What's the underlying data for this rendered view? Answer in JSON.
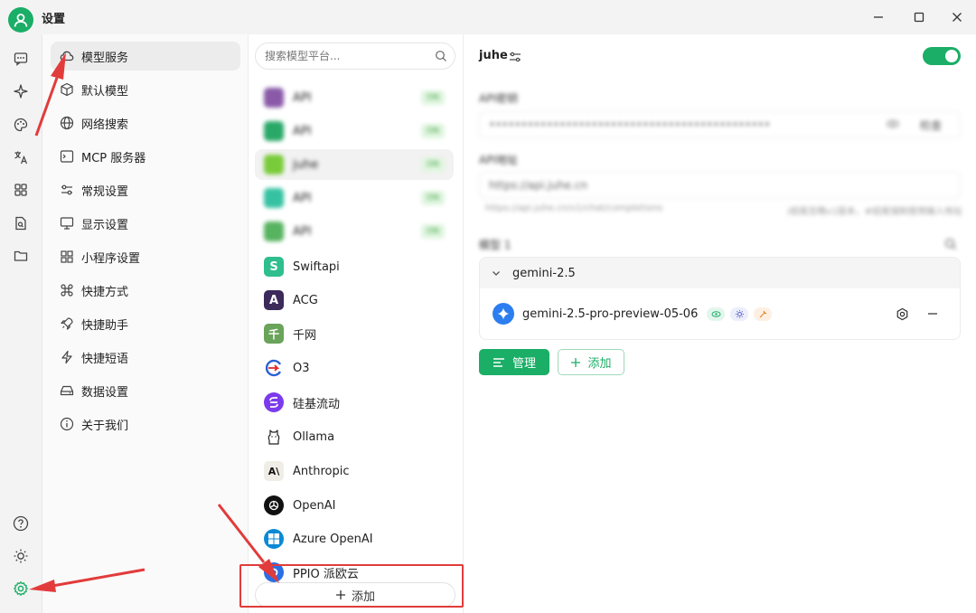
{
  "window": {
    "title": "设置"
  },
  "colors": {
    "accent": "#1aae66",
    "annotation": "#e23b3b"
  },
  "rail_icons": [
    "chat-icon",
    "sparkle-icon",
    "palette-icon",
    "translate-icon",
    "apps-grid-icon",
    "document-search-icon",
    "folder-icon",
    "help-icon",
    "brightness-icon",
    "settings-gear-icon"
  ],
  "settings_nav": [
    {
      "label": "模型服务",
      "icon": "cloud-icon",
      "active": true
    },
    {
      "label": "默认模型",
      "icon": "cube-icon"
    },
    {
      "label": "网络搜索",
      "icon": "globe-icon"
    },
    {
      "label": "MCP 服务器",
      "icon": "terminal-icon"
    },
    {
      "label": "常规设置",
      "icon": "sliders-icon"
    },
    {
      "label": "显示设置",
      "icon": "monitor-icon"
    },
    {
      "label": "小程序设置",
      "icon": "grid-icon"
    },
    {
      "label": "快捷方式",
      "icon": "command-icon"
    },
    {
      "label": "快捷助手",
      "icon": "rocket-icon"
    },
    {
      "label": "快捷短语",
      "icon": "zap-icon"
    },
    {
      "label": "数据设置",
      "icon": "drive-icon"
    },
    {
      "label": "关于我们",
      "icon": "info-icon"
    }
  ],
  "providers": {
    "search_placeholder": "搜索模型平台...",
    "items": [
      {
        "name": "API",
        "logo_color": "#8a5aa8",
        "letter": "",
        "blurred": true,
        "badge": "ON"
      },
      {
        "name": "API",
        "logo_color": "#2aa868",
        "letter": "",
        "blurred": true,
        "badge": "ON"
      },
      {
        "name": "juhe",
        "logo_color": "#7acb3a",
        "letter": "",
        "blurred": true,
        "badge": "ON",
        "active": true
      },
      {
        "name": "API",
        "logo_color": "#36c2a2",
        "letter": "",
        "blurred": true,
        "badge": "ON"
      },
      {
        "name": "API",
        "logo_color": "#57b360",
        "letter": "",
        "blurred": true,
        "badge": "ON"
      },
      {
        "name": "Swiftapi",
        "logo_color": "#2fbe8e",
        "letter": "S"
      },
      {
        "name": "ACG",
        "logo_color": "#3b2a5a",
        "letter": "A"
      },
      {
        "name": "千网",
        "logo_color": "#6aa35a",
        "letter": "千"
      },
      {
        "name": "O3",
        "logo_color": "#ffffff",
        "letter": ""
      },
      {
        "name": "硅基流动",
        "logo_color": "#7c3aed",
        "letter": ""
      },
      {
        "name": "Ollama",
        "logo_color": "#ffffff",
        "letter": ""
      },
      {
        "name": "Anthropic",
        "logo_color": "#f0ede6",
        "letter": "A\\"
      },
      {
        "name": "OpenAI",
        "logo_color": "#111111",
        "letter": ""
      },
      {
        "name": "Azure OpenAI",
        "logo_color": "#0a8ad6",
        "letter": ""
      },
      {
        "name": "PPIO 派欧云",
        "logo_color": "#2b6fe6",
        "letter": ""
      }
    ],
    "add_label": "添加"
  },
  "detail": {
    "provider_name": "juhe",
    "enabled": true,
    "api_key": {
      "label": "API密钥",
      "value": "••••••••••••••••••••••••••••••••••••••••••••",
      "check_label": "检查"
    },
    "api_host": {
      "label": "API地址",
      "value": "https://api.juhe.cn",
      "hint_left": "https://api.juhe.cn/v1/chat/completions",
      "hint_right": "/结尾忽略v1版本，#结尾强制使用输入地址"
    },
    "models_label": "模型",
    "model_count": "1",
    "group": {
      "name": "gemini-2.5",
      "models": [
        {
          "name": "gemini-2.5-pro-preview-05-06",
          "tags": [
            "vision",
            "reasoning",
            "tools"
          ]
        }
      ]
    },
    "manage_label": "管理",
    "add_label": "添加"
  }
}
